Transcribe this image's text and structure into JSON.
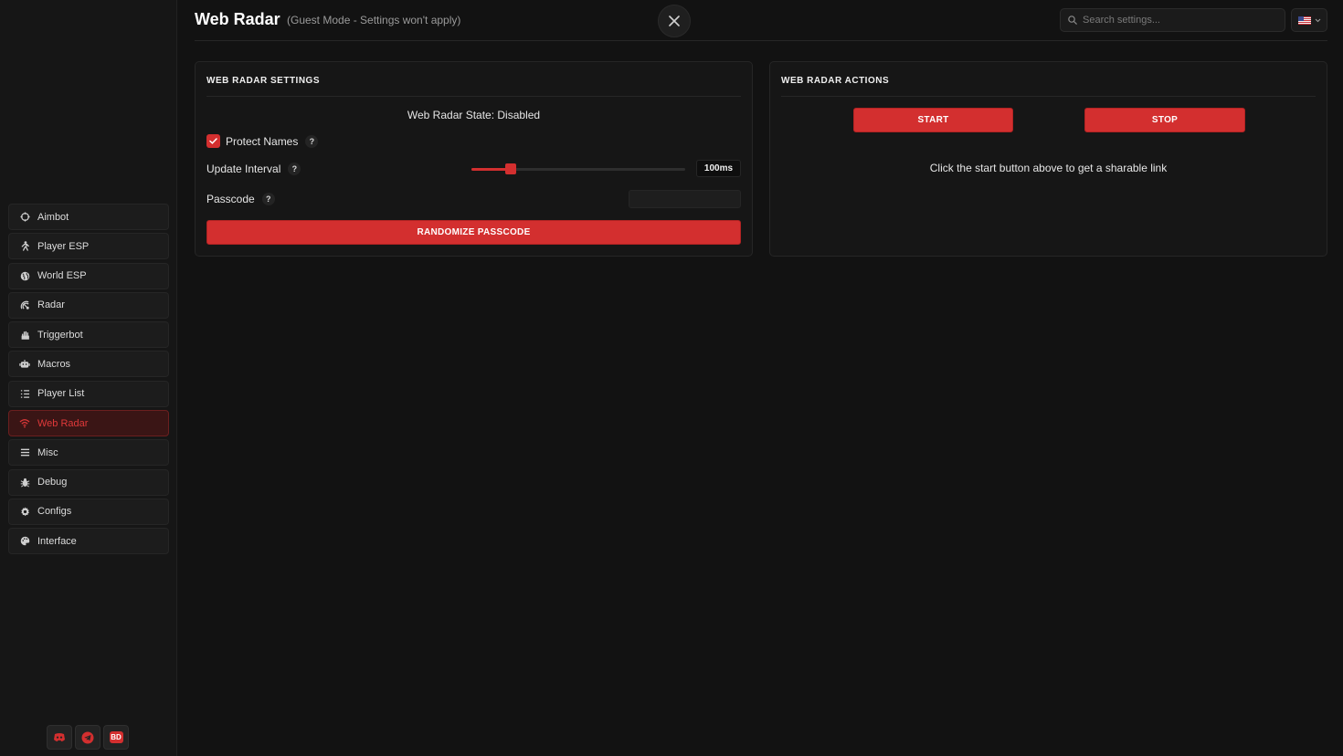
{
  "header": {
    "title": "Web Radar",
    "subtitle": "(Guest Mode - Settings won't apply)",
    "search_placeholder": "Search settings..."
  },
  "sidebar": {
    "items": [
      {
        "label": "Aimbot",
        "icon": "crosshair-icon",
        "active": false
      },
      {
        "label": "Player ESP",
        "icon": "person-icon",
        "active": false
      },
      {
        "label": "World ESP",
        "icon": "globe-icon",
        "active": false
      },
      {
        "label": "Radar",
        "icon": "radar-icon",
        "active": false
      },
      {
        "label": "Triggerbot",
        "icon": "hand-icon",
        "active": false
      },
      {
        "label": "Macros",
        "icon": "robot-icon",
        "active": false
      },
      {
        "label": "Player List",
        "icon": "list-icon",
        "active": false
      },
      {
        "label": "Web Radar",
        "icon": "wifi-icon",
        "active": true
      },
      {
        "label": "Misc",
        "icon": "menu-icon",
        "active": false
      },
      {
        "label": "Debug",
        "icon": "bug-icon",
        "active": false
      },
      {
        "label": "Configs",
        "icon": "gear-icon",
        "active": false
      },
      {
        "label": "Interface",
        "icon": "palette-icon",
        "active": false
      }
    ],
    "social": {
      "bd_label": "BD"
    }
  },
  "settings_panel": {
    "title": "WEB RADAR SETTINGS",
    "state_text": "Web Radar State: Disabled",
    "protect_names": {
      "label": "Protect Names",
      "checked": true
    },
    "update_interval": {
      "label": "Update Interval",
      "value_text": "100ms",
      "fraction": 0.185
    },
    "passcode": {
      "label": "Passcode",
      "value": ""
    },
    "randomize_button": "RANDOMIZE PASSCODE",
    "help_glyph": "?"
  },
  "actions_panel": {
    "title": "WEB RADAR ACTIONS",
    "start_button": "START",
    "stop_button": "STOP",
    "hint": "Click the start button above to get a sharable link"
  },
  "colors": {
    "accent": "#d32f2f",
    "background": "#121212",
    "panel": "#161616"
  }
}
